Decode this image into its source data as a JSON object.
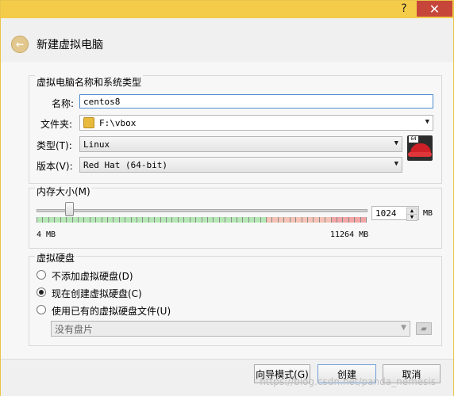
{
  "window": {
    "title_buttons": {
      "help": "?",
      "close": "✕"
    }
  },
  "header": {
    "back_icon": "back-arrow-icon",
    "title": "新建虚拟电脑"
  },
  "name_os_group": {
    "title": "虚拟电脑名称和系统类型",
    "name_label": "名称:",
    "name_value": "centos8",
    "folder_label": "文件夹:",
    "folder_value": "F:\\vbox",
    "type_label": "类型(T):",
    "type_value": "Linux",
    "version_label": "版本(V):",
    "version_value": "Red Hat (64-bit)",
    "os_icon": "redhat-64-icon",
    "os_badge": "64"
  },
  "memory_group": {
    "title": "内存大小(M)",
    "value": "1024",
    "unit": "MB",
    "min_label": "4 MB",
    "max_label": "11264 MB"
  },
  "disk_group": {
    "title": "虚拟硬盘",
    "options": [
      {
        "label": "不添加虚拟硬盘(D)",
        "checked": false
      },
      {
        "label": "现在创建虚拟硬盘(C)",
        "checked": true
      },
      {
        "label": "使用已有的虚拟硬盘文件(U)",
        "checked": false
      }
    ],
    "existing_disk_value": "没有盘片"
  },
  "footer": {
    "guided_mode_label": "向导模式(G)",
    "create_label": "创建",
    "cancel_label": "取消",
    "watermark": "https://blog.csdn.net/panda_nemesis"
  }
}
